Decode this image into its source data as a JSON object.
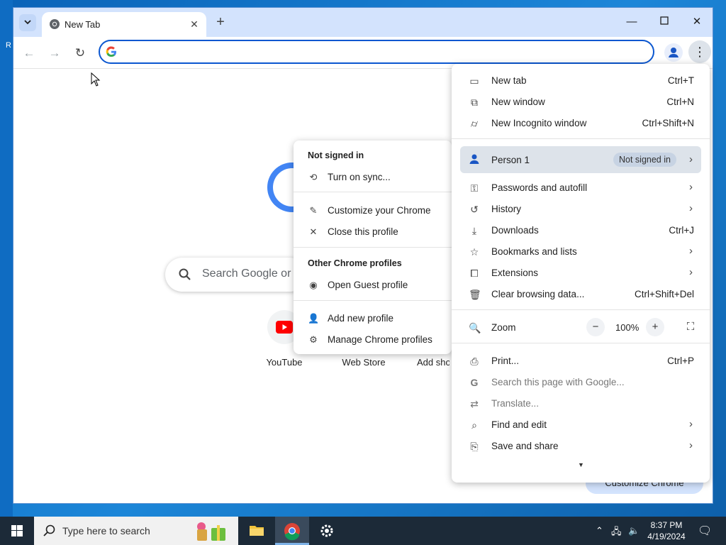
{
  "browser": {
    "tab": {
      "title": "New Tab"
    },
    "omnibox": {
      "value": "",
      "placeholder": ""
    }
  },
  "ntp": {
    "search_placeholder": "Search Google or t",
    "shortcuts": [
      {
        "label": "YouTube"
      },
      {
        "label": "Web Store"
      },
      {
        "label": "Add shor"
      }
    ],
    "customize_button": "Customize Chrome"
  },
  "menu": {
    "new_tab": {
      "label": "New tab",
      "shortcut": "Ctrl+T"
    },
    "new_window": {
      "label": "New window",
      "shortcut": "Ctrl+N"
    },
    "new_incognito": {
      "label": "New Incognito window",
      "shortcut": "Ctrl+Shift+N"
    },
    "person": {
      "label": "Person 1",
      "badge": "Not signed in"
    },
    "passwords": {
      "label": "Passwords and autofill"
    },
    "history": {
      "label": "History"
    },
    "downloads": {
      "label": "Downloads",
      "shortcut": "Ctrl+J"
    },
    "bookmarks": {
      "label": "Bookmarks and lists"
    },
    "extensions": {
      "label": "Extensions"
    },
    "clear_data": {
      "label": "Clear browsing data...",
      "shortcut": "Ctrl+Shift+Del"
    },
    "zoom": {
      "label": "Zoom",
      "value": "100%"
    },
    "print": {
      "label": "Print...",
      "shortcut": "Ctrl+P"
    },
    "search_page": {
      "label": "Search this page with Google..."
    },
    "translate": {
      "label": "Translate..."
    },
    "find_edit": {
      "label": "Find and edit"
    },
    "save_share": {
      "label": "Save and share"
    }
  },
  "profile_submenu": {
    "header_signed": "Not signed in",
    "turn_on_sync": "Turn on sync...",
    "customize": "Customize your Chrome",
    "close_profile": "Close this profile",
    "header_other": "Other Chrome profiles",
    "open_guest": "Open Guest profile",
    "add_new": "Add new profile",
    "manage": "Manage Chrome profiles"
  },
  "taskbar": {
    "search_placeholder": "Type here to search",
    "time": "8:37 PM",
    "date": "4/19/2024"
  },
  "colors": {
    "accent": "#0b57d0",
    "titlebar": "#d3e3fd",
    "taskbar": "#1c2a38",
    "menu_highlight": "#dde3ea"
  }
}
